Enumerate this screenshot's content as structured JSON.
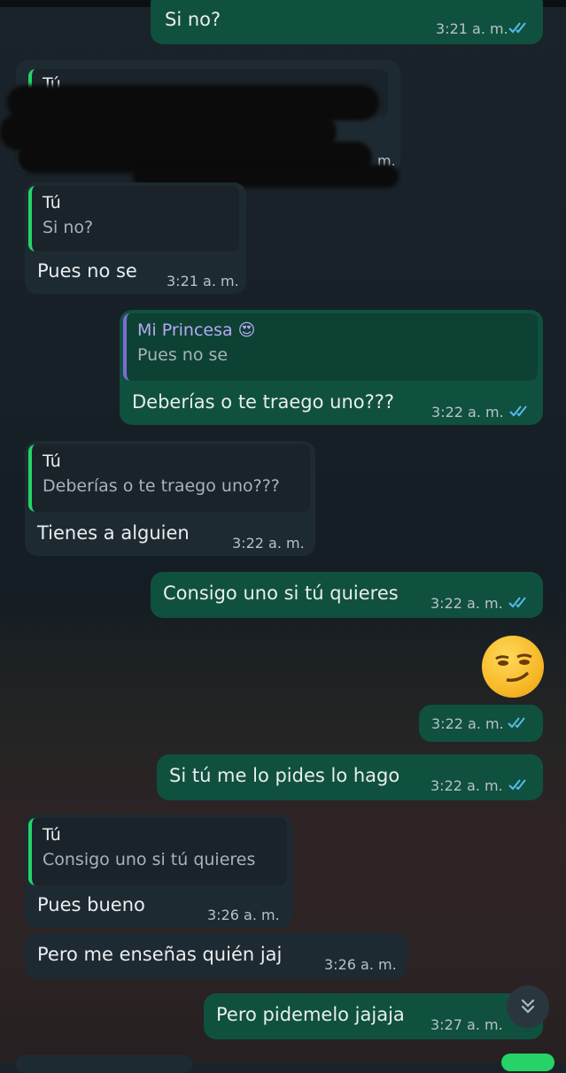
{
  "messages": [
    {
      "text": "Si no?",
      "time": "3:21 a. m."
    },
    {
      "quote_name": "Tú",
      "partial_time": "m."
    },
    {
      "quote_name": "Tú",
      "quote_text": "Si no?",
      "text": "Pues no se",
      "time": "3:21 a. m."
    },
    {
      "quote_name": "Mi Princesa 😍",
      "quote_text": "Pues no se",
      "text": "Deberías o te traego uno???",
      "time": "3:22 a. m."
    },
    {
      "quote_name": "Tú",
      "quote_text": "Deberías o te traego uno???",
      "text": "Tienes a alguien",
      "time": "3:22 a. m."
    },
    {
      "text": "Consigo uno si tú quieres",
      "time": "3:22 a. m."
    },
    {
      "emoji": "smirking-face",
      "time": "3:22 a. m."
    },
    {
      "text": "Si tú me lo pides lo hago",
      "time": "3:22 a. m."
    },
    {
      "quote_name": "Tú",
      "quote_text": "Consigo uno si tú quieres",
      "text": "Pues bueno",
      "time": "3:26 a. m."
    },
    {
      "text": "Pero me enseñas quién jaj",
      "time": "3:26 a. m."
    },
    {
      "text": "Pero pidemelo jajaja",
      "time": "3:27 a. m."
    }
  ],
  "colors": {
    "incoming_bubble": "#1e2a31",
    "outgoing_bubble": "#10503f",
    "read_ticks": "#53bdeb",
    "quote_bar_in": "#25d366",
    "quote_bar_out": "#7b6bd6"
  },
  "icons": {
    "scroll_down": "double-chevron-down-icon",
    "read_receipt": "double-check-icon"
  }
}
